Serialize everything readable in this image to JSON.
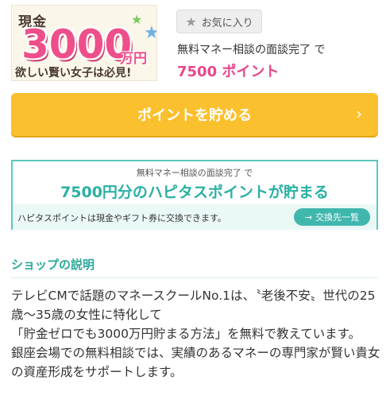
{
  "banner": {
    "line1": "現金",
    "amount": "3000",
    "unit": "万円",
    "line3": "欲しい賢い女子は必見!"
  },
  "favorite": {
    "label": "お気に入り",
    "icon": "star-icon"
  },
  "condition": {
    "text": "無料マネー相談の面談完了 で"
  },
  "points": {
    "text": "7500 ポイント",
    "color": "#e9478a"
  },
  "save_button": {
    "label": "ポイントを貯める",
    "color": "#fbc02d"
  },
  "hapitas": {
    "sub": "無料マネー相談の面談完了 で",
    "main": "7500円分のハピタスポイントが貯まる",
    "note": "ハピタスポイントは現金やギフト券に交換できます。",
    "exchange_label": "交換先一覧",
    "accent": "#3fb7ad"
  },
  "shop": {
    "title": "ショップの説明",
    "lines": [
      "テレビCMで話題のマネースクールNo.1は、〝老後不安〟世代の25歳〜35歳の女性に特化して",
      "「貯金ゼロでも3000万円貯まる方法」を無料で教えています。",
      "銀座会場での無料相談では、実績のあるマネーの専門家が賢い貴女の資産形成をサポートします。"
    ]
  }
}
